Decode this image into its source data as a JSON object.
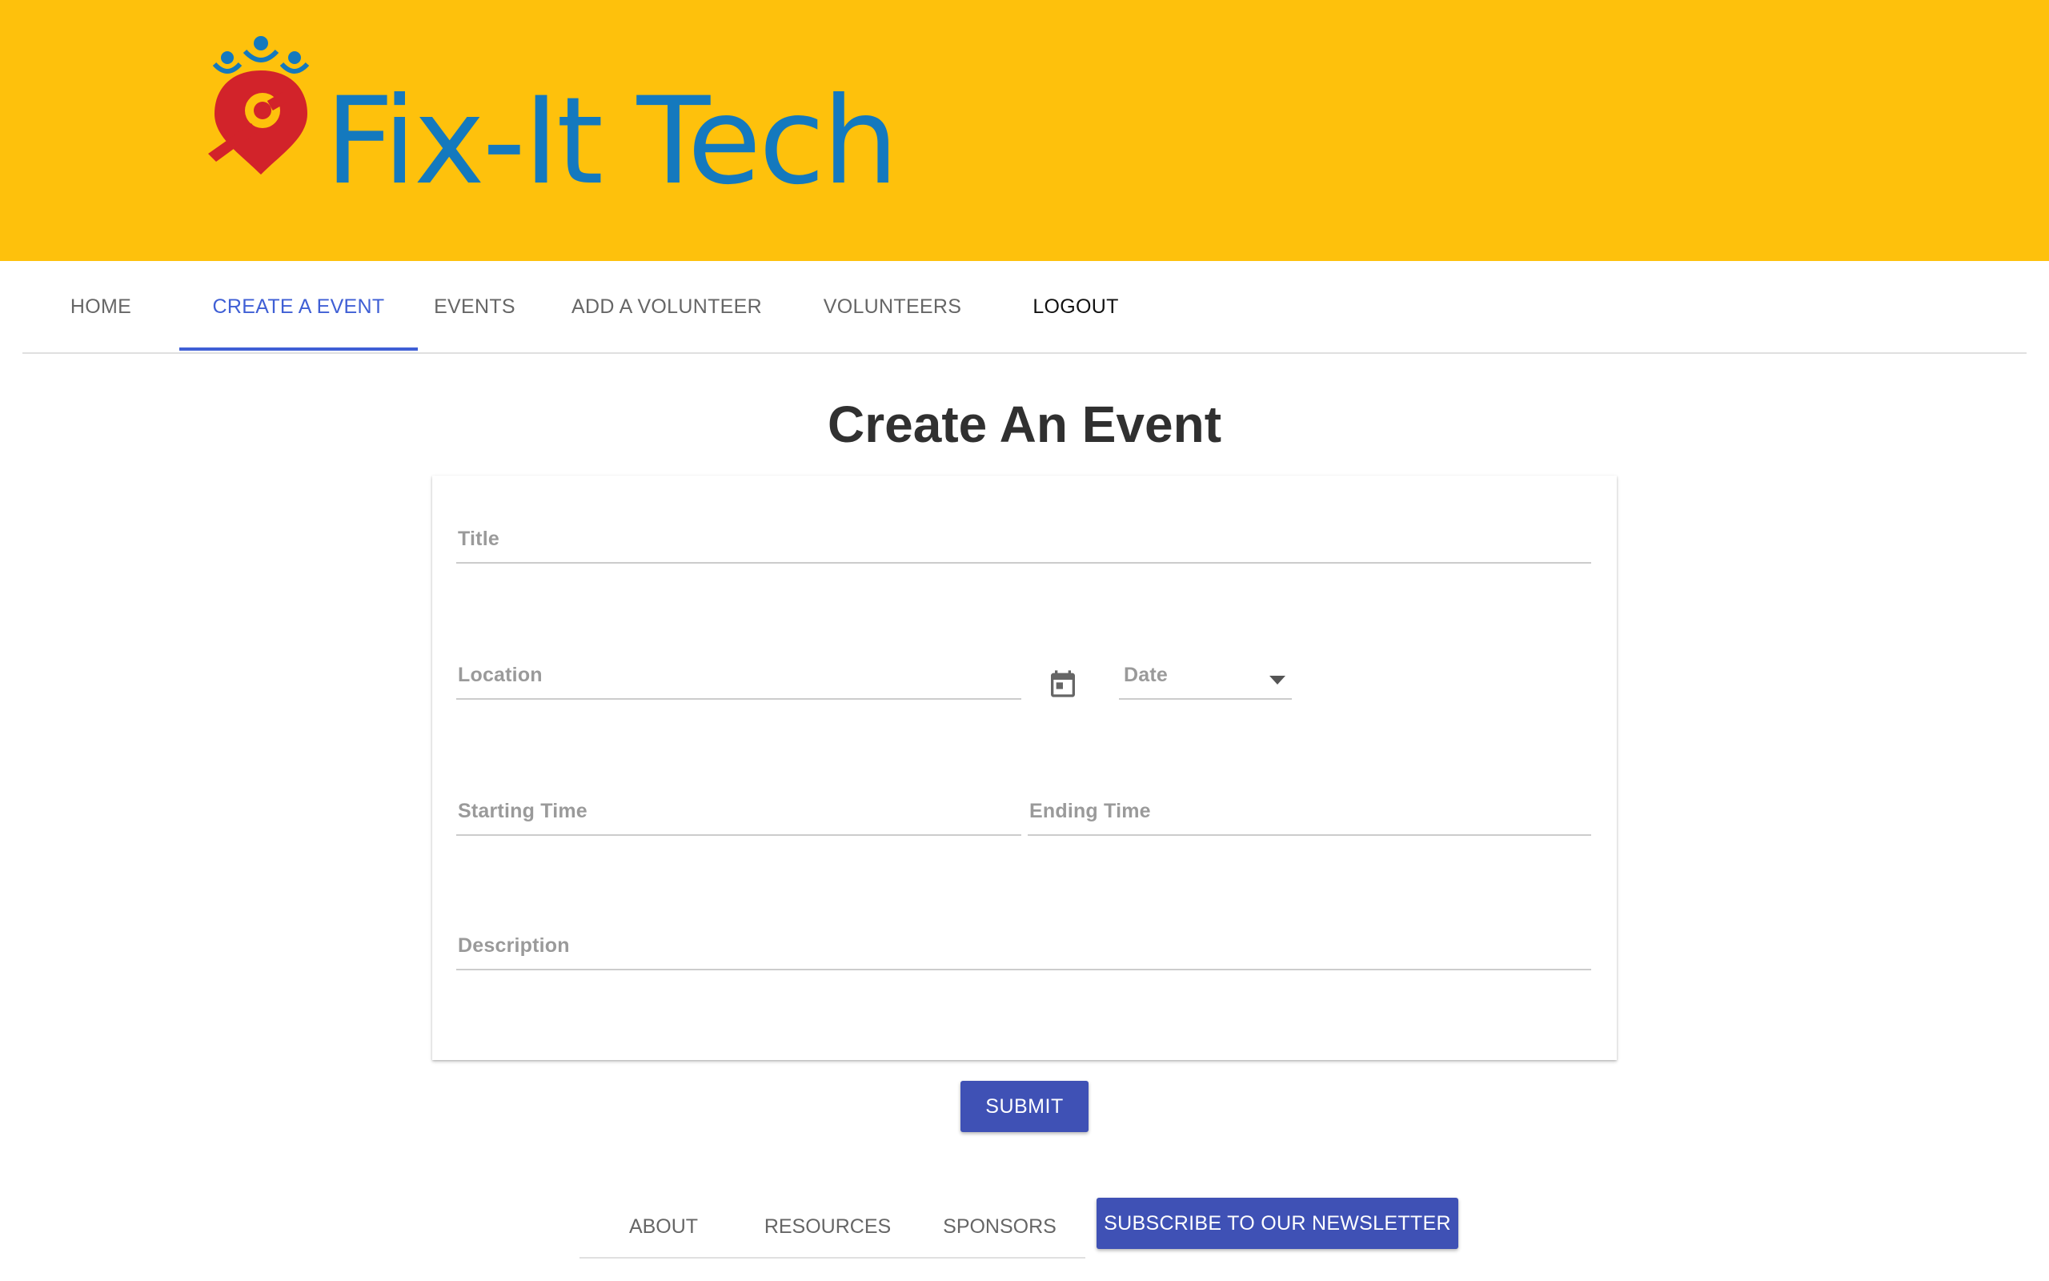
{
  "header": {
    "brand": "Fix-It Tech",
    "background_color": "#fec10c",
    "brand_color": "#1479be",
    "logo_icon": "wrench-location-pin-icon"
  },
  "nav": {
    "tabs": [
      {
        "label": "HOME"
      },
      {
        "label": "CREATE A EVENT"
      },
      {
        "label": "EVENTS"
      },
      {
        "label": "ADD A VOLUNTEER"
      },
      {
        "label": "VOLUNTEERS"
      },
      {
        "label": "LOGOUT"
      }
    ],
    "active_tab": "CREATE A EVENT",
    "accent_color": "#3f5fd5"
  },
  "main": {
    "title": "Create An Event",
    "form": {
      "title_label": "Title",
      "location_label": "Location",
      "date_label": "Date",
      "date_icon": "calendar-icon",
      "start_time_label": "Starting Time",
      "end_time_label": "Ending Time",
      "description_label": "Description"
    },
    "submit_label": "SUBMIT",
    "button_color": "#3f51b5"
  },
  "footer": {
    "tabs": [
      {
        "label": "ABOUT"
      },
      {
        "label": "RESOURCES"
      },
      {
        "label": "SPONSORS"
      }
    ],
    "newsletter_label": "SUBSCRIBE TO OUR NEWSLETTER"
  }
}
